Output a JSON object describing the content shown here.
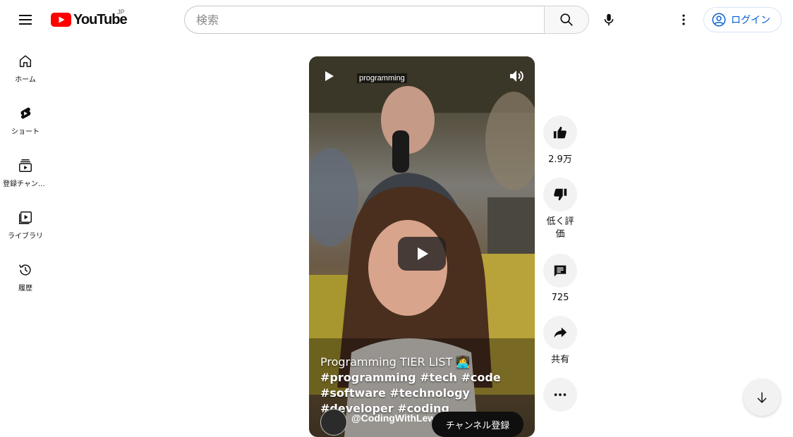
{
  "header": {
    "logo_text": "YouTube",
    "region": "JP",
    "search_placeholder": "検索",
    "login_label": "ログイン"
  },
  "sidebar": {
    "items": [
      {
        "label": "ホーム",
        "icon": "home-icon"
      },
      {
        "label": "ショート",
        "icon": "shorts-icon"
      },
      {
        "label": "登録チャンネル",
        "icon": "subscriptions-icon"
      },
      {
        "label": "ライブラリ",
        "icon": "library-icon"
      },
      {
        "label": "履歴",
        "icon": "history-icon"
      }
    ]
  },
  "video": {
    "tag": "programming",
    "title": "Programming TIER LIST 👩‍💻",
    "hashtags": "#programming #tech #code #software #technology #developer #coding",
    "channel": "@CodingWithLewis",
    "subscribe_label": "チャンネル登録"
  },
  "actions": {
    "like_count": "2.9万",
    "dislike_label": "低く評価",
    "comment_count": "725",
    "share_label": "共有"
  },
  "colors": {
    "brand_red": "#ff0000",
    "link_blue": "#065fd4"
  }
}
